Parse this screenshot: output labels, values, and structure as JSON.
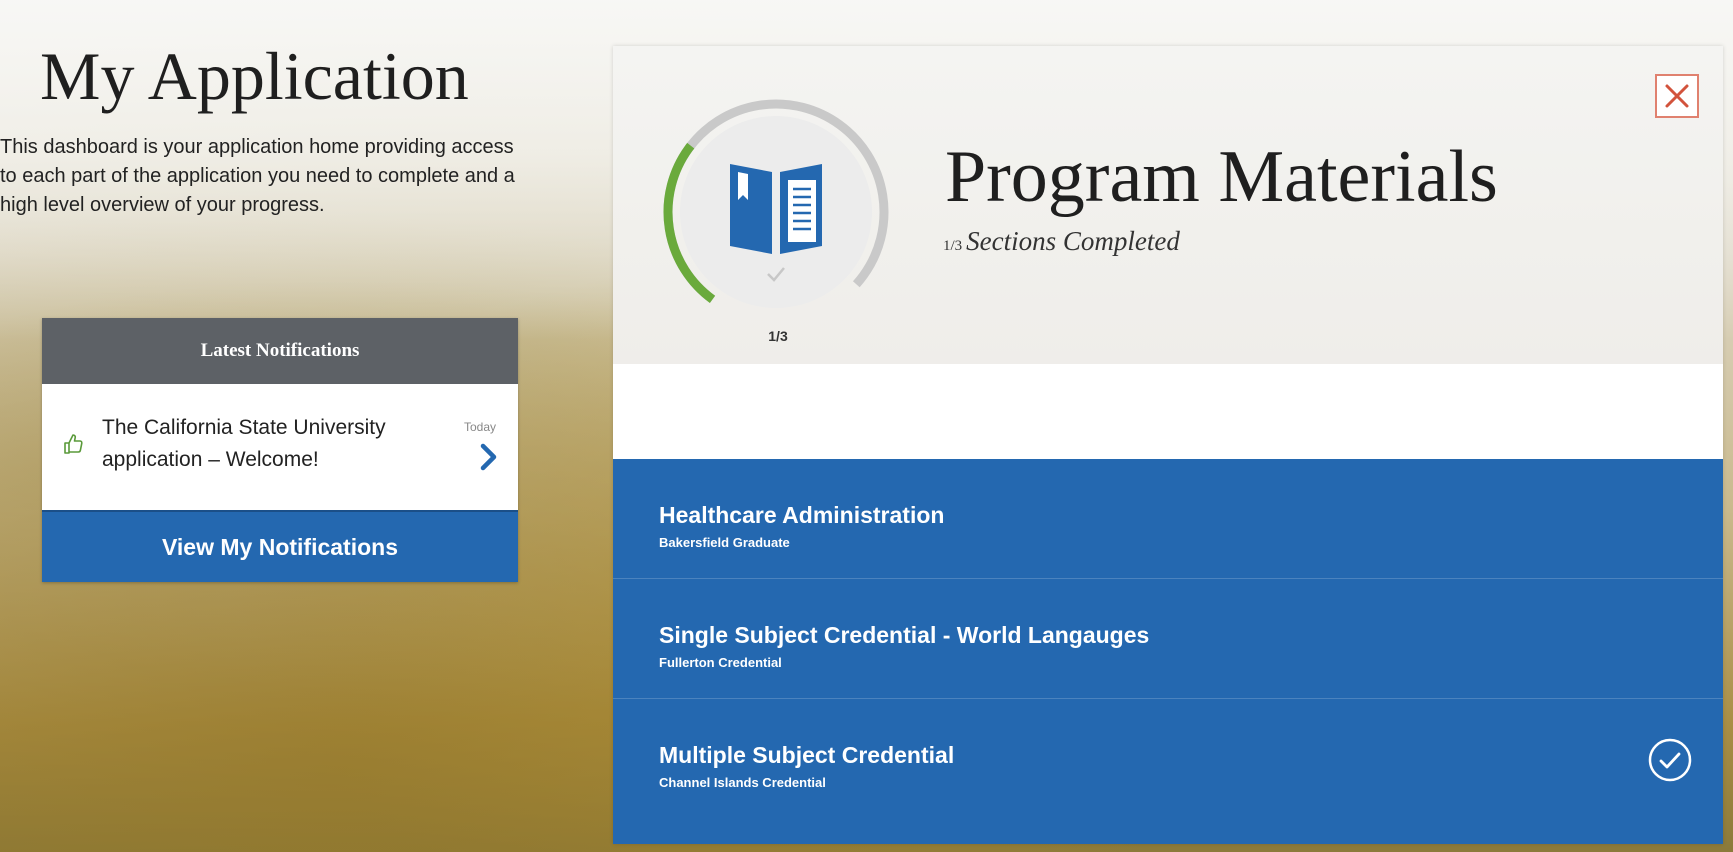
{
  "app": {
    "title": "My Application",
    "description": "This dashboard is your application home providing access to each part of the application you need to complete and a high level overview of your progress."
  },
  "notifications": {
    "header": "Latest Notifications",
    "items": [
      {
        "icon": "thumbs-up-icon",
        "text": "The California State University application – Welcome!",
        "time": "Today"
      }
    ],
    "button_label": "View My Notifications"
  },
  "panel": {
    "title": "Program Materials",
    "completed_count": "1/3",
    "completed_label": "Sections Completed",
    "progress_label": "1/3",
    "progress_fraction": 0.333,
    "section_icon": "book-icon",
    "colors": {
      "progress": "#6aaa3c",
      "accent": "#2468b0",
      "close": "#e0816f"
    }
  },
  "programs": [
    {
      "name": "Healthcare Administration",
      "campus": "Bakersfield Graduate",
      "completed": false
    },
    {
      "name": "Single Subject Credential - World Langauges",
      "campus": "Fullerton Credential",
      "completed": false
    },
    {
      "name": "Multiple Subject Credential",
      "campus": "Channel Islands Credential",
      "completed": true
    }
  ]
}
